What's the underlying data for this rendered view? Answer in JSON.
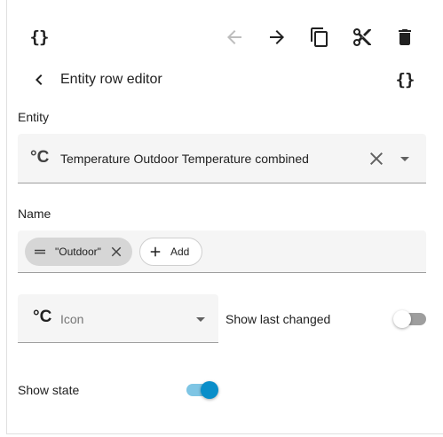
{
  "toolbar": {
    "yaml_icon_text": "{}",
    "back_icon": "arrow-left-icon",
    "forward_icon": "arrow-right-icon",
    "copy_icon": "copy-icon",
    "cut_icon": "scissors-icon",
    "delete_icon": "delete-icon"
  },
  "header": {
    "title": "Entity row editor",
    "yaml_toggle_text": "{}"
  },
  "entity": {
    "label": "Entity",
    "unit_symbol": "°C",
    "value": "Temperature Outdoor Temperature combined"
  },
  "name": {
    "label": "Name",
    "chip_label": "\"Outdoor\"",
    "add_label": "Add"
  },
  "icon_field": {
    "unit_symbol": "°C",
    "placeholder": "Icon"
  },
  "toggles": {
    "show_last_changed": {
      "label": "Show last changed",
      "on": false
    },
    "show_state": {
      "label": "Show state",
      "on": true
    }
  },
  "colors": {
    "accent": "#0a8ec9",
    "accent_track": "#7ec5e4",
    "off_track": "#9e9e9e",
    "disabled_icon": "#bdbdbd",
    "field_bg": "#f5f5f5",
    "chip_bg": "#d6d6d6"
  }
}
